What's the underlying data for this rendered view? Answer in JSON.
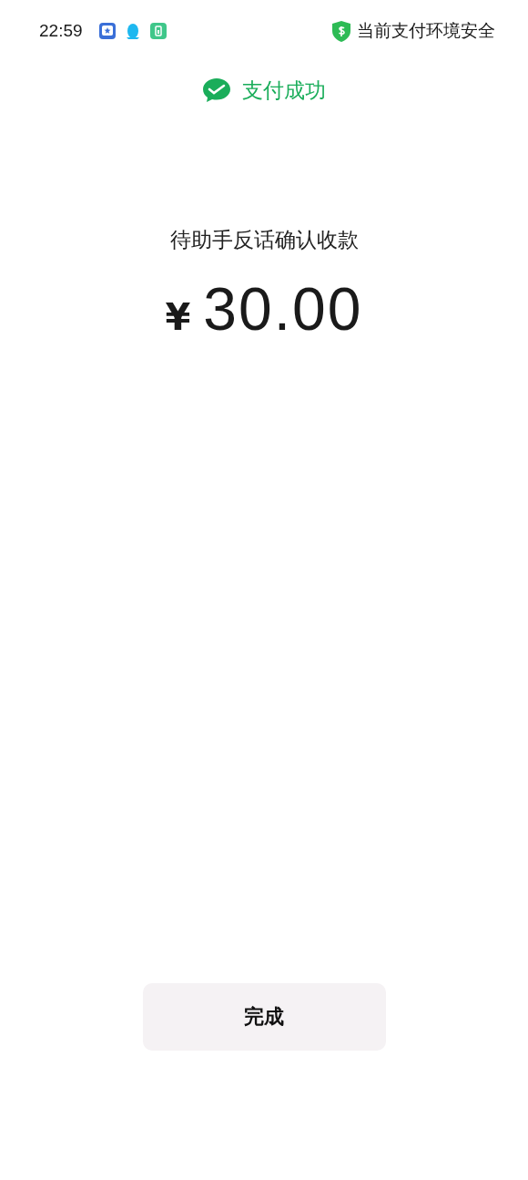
{
  "status_bar": {
    "time": "22:59",
    "security": "当前支付环境安全"
  },
  "header": {
    "title": "支付成功"
  },
  "payment": {
    "note": "待助手反话确认收款",
    "currency": "¥",
    "amount": "30.00"
  },
  "buttons": [
    {
      "label": "完成",
      "kind": "primary"
    }
  ]
}
